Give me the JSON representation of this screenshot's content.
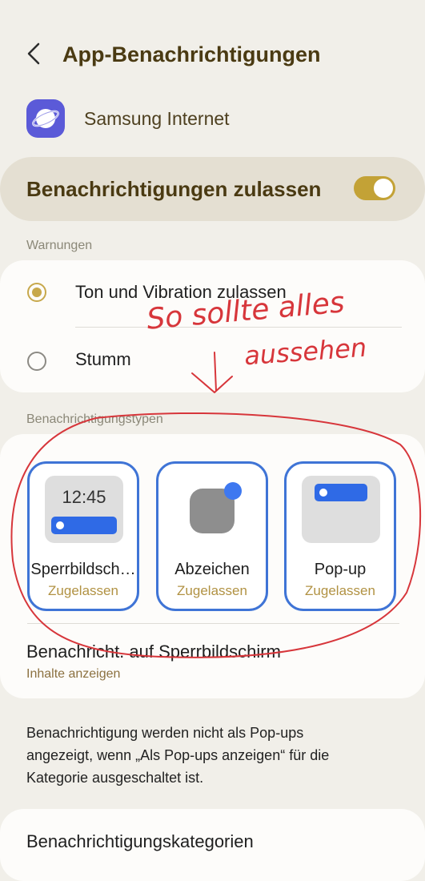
{
  "header": {
    "title": "App-Benachrichtigungen"
  },
  "app": {
    "name": "Samsung Internet",
    "icon": "samsung-internet-icon"
  },
  "allow": {
    "label": "Benachrichtigungen zulassen",
    "enabled": true
  },
  "warnings": {
    "section_label": "Warnungen",
    "options": [
      {
        "label": "Ton und Vibration zulassen",
        "checked": true
      },
      {
        "label": "Stumm",
        "checked": false
      }
    ]
  },
  "types": {
    "section_label": "Benachrichtigungstypen",
    "items": [
      {
        "label": "Sperrbildsch…",
        "status": "Zugelassen",
        "preview_time": "12:45"
      },
      {
        "label": "Abzeichen",
        "status": "Zugelassen"
      },
      {
        "label": "Pop-up",
        "status": "Zugelassen"
      }
    ],
    "lockscreen": {
      "title": "Benachricht. auf Sperrbildschirm",
      "subtitle": "Inhalte anzeigen"
    }
  },
  "info": {
    "text": "Benachrichtigung werden nicht als Pop-ups angezeigt, wenn „Als Pop-ups anzeigen“ für die Kategorie ausgeschaltet ist."
  },
  "categories": {
    "label": "Benachrichtigungskategorien"
  },
  "annotation": {
    "line1": "So sollte alles",
    "line2": "aussehen"
  },
  "colors": {
    "accent": "#c3a236",
    "blue": "#3f74d6",
    "annotation_red": "#d7363b"
  }
}
